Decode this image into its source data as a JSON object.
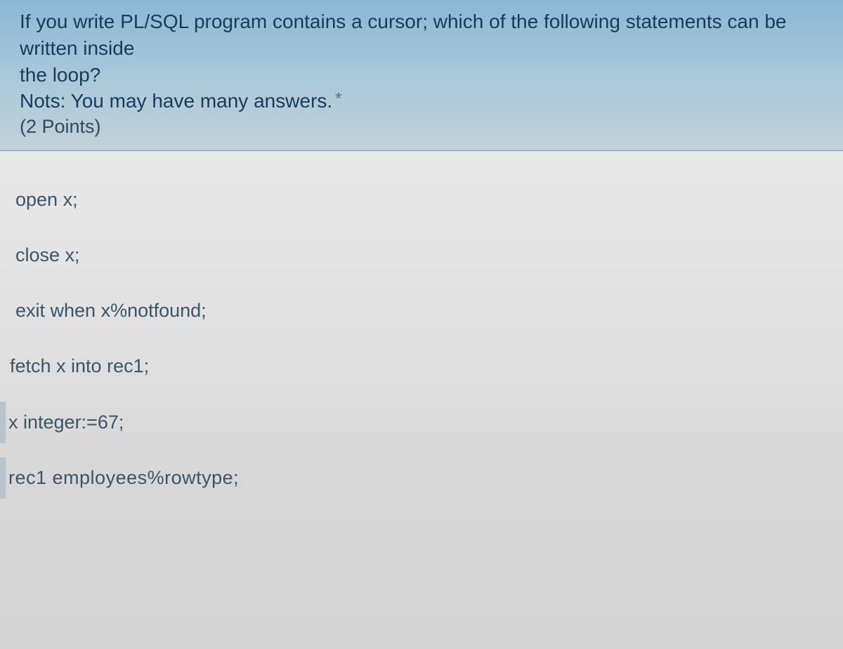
{
  "question": {
    "line1": "If you write PL/SQL program contains a cursor; which of the following statements can be written inside",
    "line2": "the loop?",
    "note": "Nots: You may have many answers.",
    "asterisk": "*",
    "points": "(2 Points)"
  },
  "options": [
    "open x;",
    "close x;",
    "exit when x%notfound;",
    "fetch x into rec1;",
    "x integer:=67;",
    "rec1   employees%rowtype;"
  ]
}
